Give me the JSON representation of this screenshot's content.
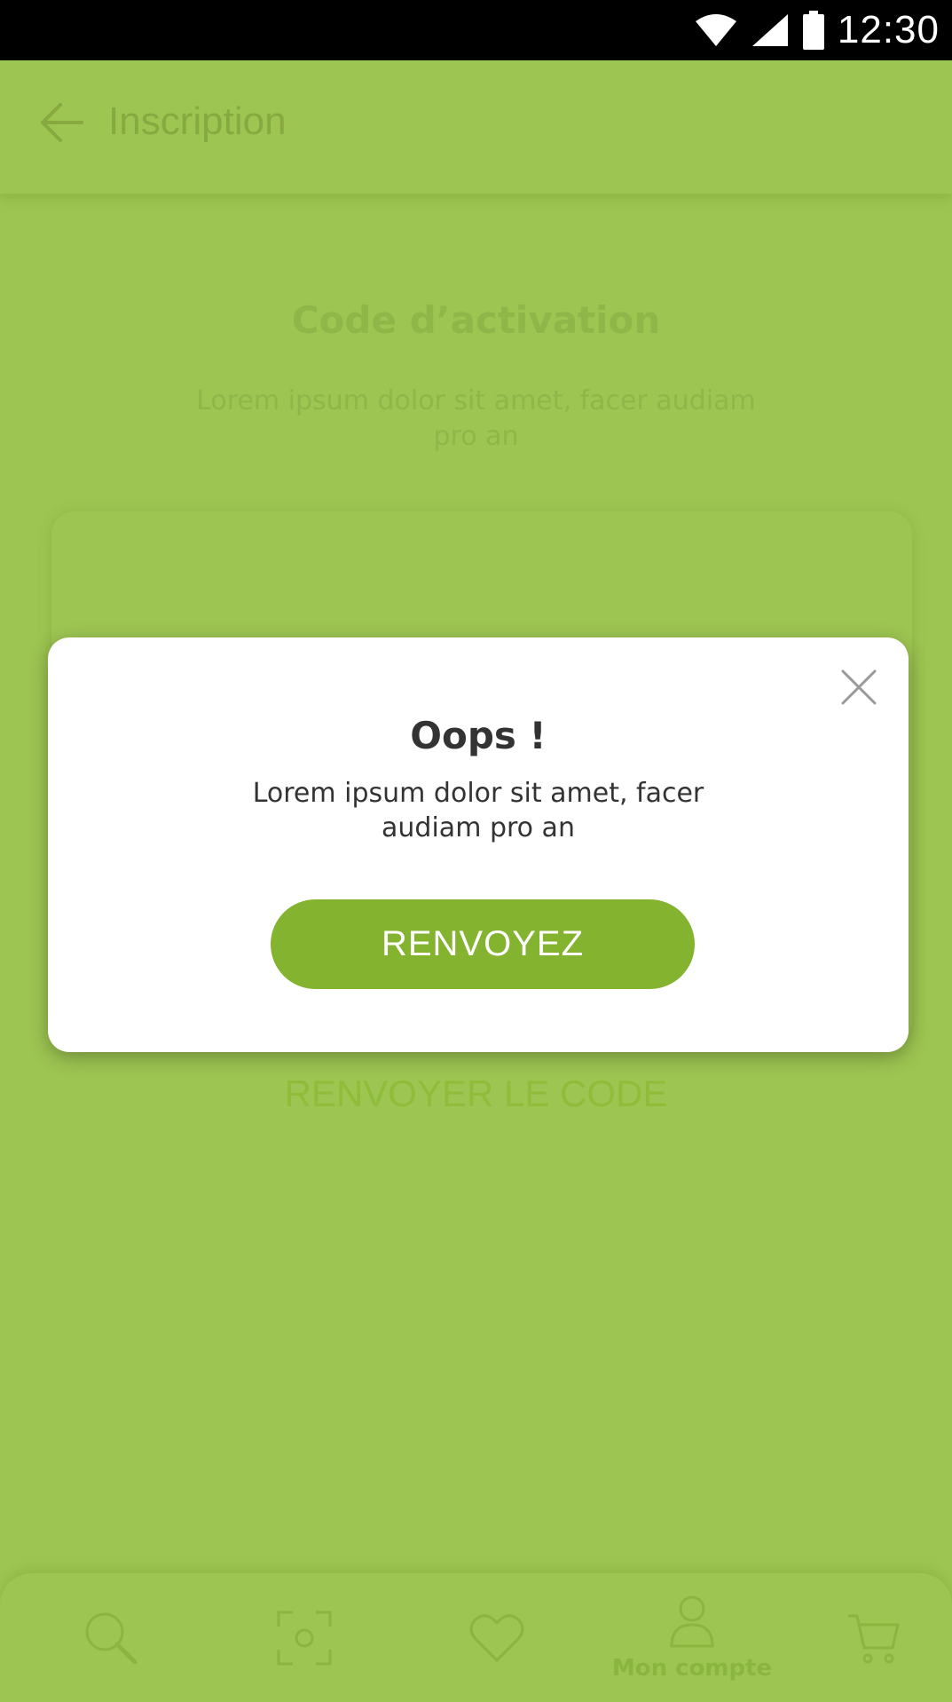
{
  "status_bar": {
    "time": "12:30"
  },
  "app_bar": {
    "title": "Inscription"
  },
  "content": {
    "title": "Code d’activation",
    "description": "Lorem ipsum dolor sit amet, facer audiam pro an",
    "resend_link": "RENVOYER LE CODE"
  },
  "modal": {
    "title": "Oops !",
    "message": "Lorem ipsum dolor sit amet, facer audiam pro an",
    "button": "RENVOYEZ"
  },
  "bottom_nav": {
    "items": [
      {
        "icon": "search-icon",
        "label": ""
      },
      {
        "icon": "scan-icon",
        "label": ""
      },
      {
        "icon": "heart-icon",
        "label": ""
      },
      {
        "icon": "user-icon",
        "label": "Mon compte"
      },
      {
        "icon": "cart-icon",
        "label": ""
      }
    ]
  },
  "colors": {
    "background": "#9dc552",
    "button": "#84b32f",
    "modal": "#ffffff"
  }
}
